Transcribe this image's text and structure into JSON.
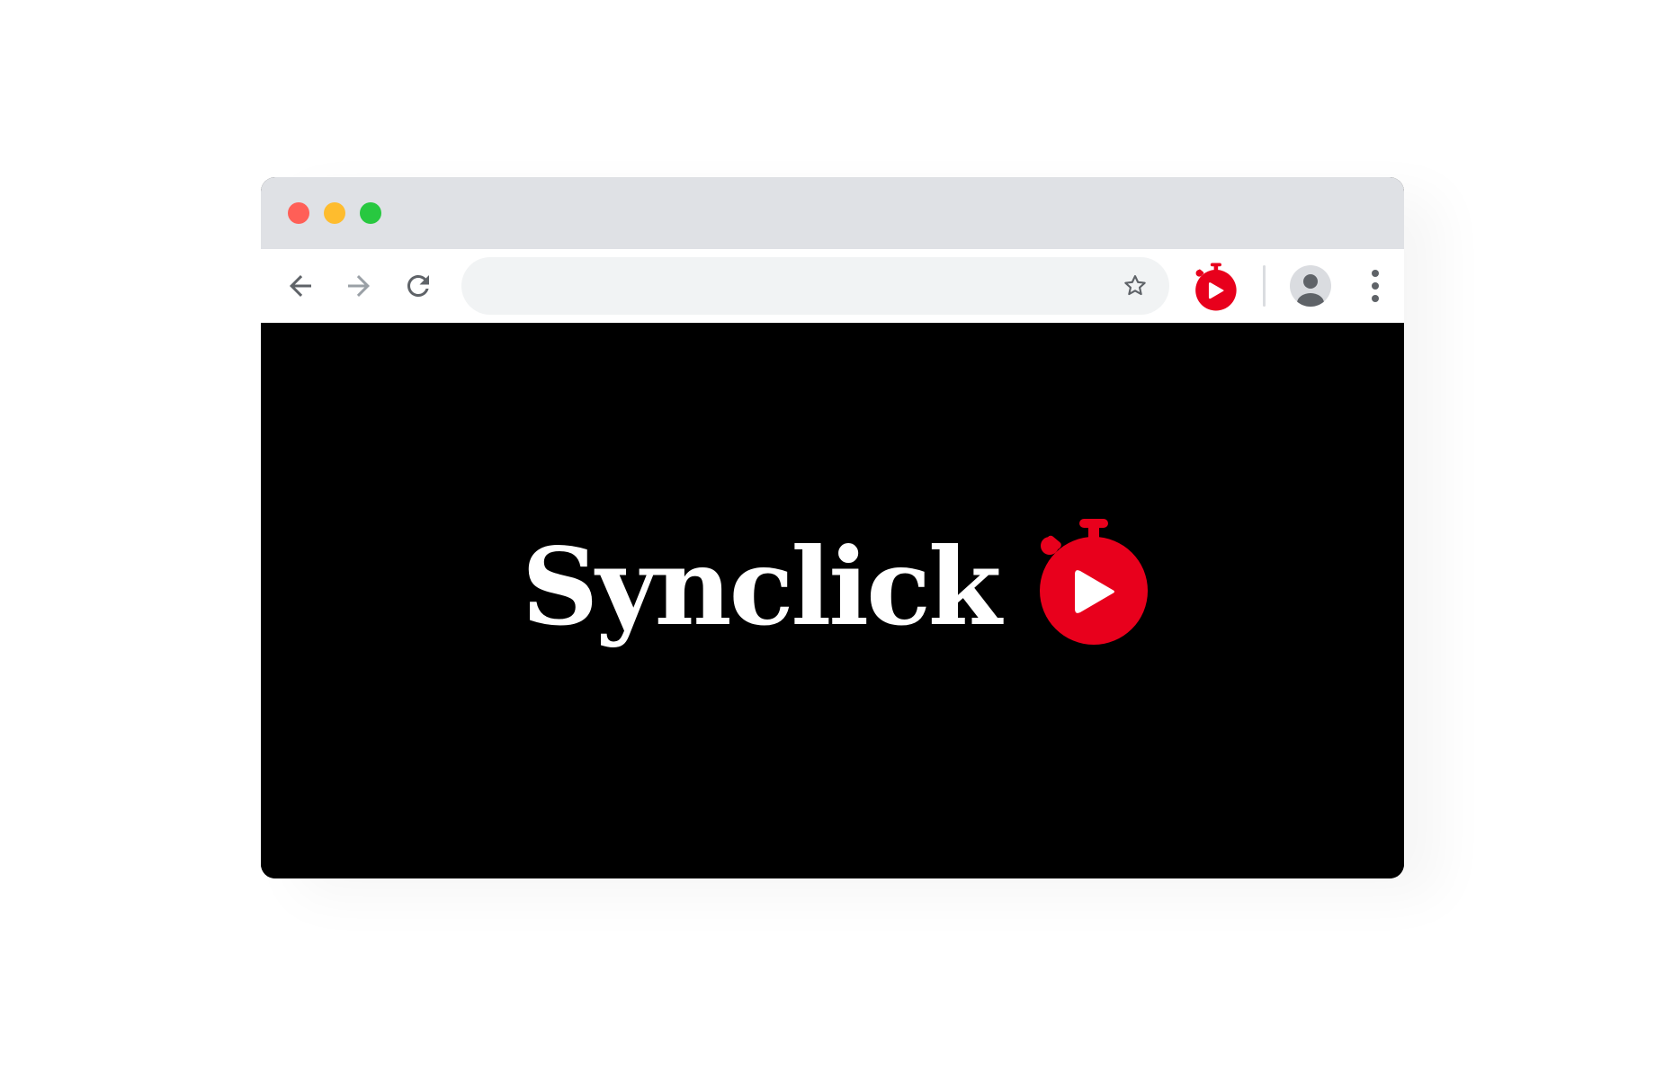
{
  "window": {
    "traffic_lights": [
      {
        "name": "close",
        "color": "#ff5f57"
      },
      {
        "name": "minimize",
        "color": "#febc2e"
      },
      {
        "name": "maximize",
        "color": "#28c840"
      }
    ]
  },
  "toolbar": {
    "back_icon": "arrow-left-icon",
    "forward_icon": "arrow-right-icon",
    "reload_icon": "reload-icon",
    "address_value": "",
    "bookmark_icon": "star-icon",
    "extension_icon": "synclick-stopwatch-play-icon",
    "profile_icon": "user-avatar-icon",
    "menu_icon": "kebab-menu-icon"
  },
  "content": {
    "logo_text": "Synclick",
    "logo_icon": "stopwatch-play-icon"
  },
  "colors": {
    "title_bar": "#dfe1e5",
    "omnibox": "#f1f3f4",
    "brand_red": "#e8001c",
    "icon_gray": "#5f6368",
    "content_bg": "#000000",
    "logo_text": "#ffffff"
  }
}
